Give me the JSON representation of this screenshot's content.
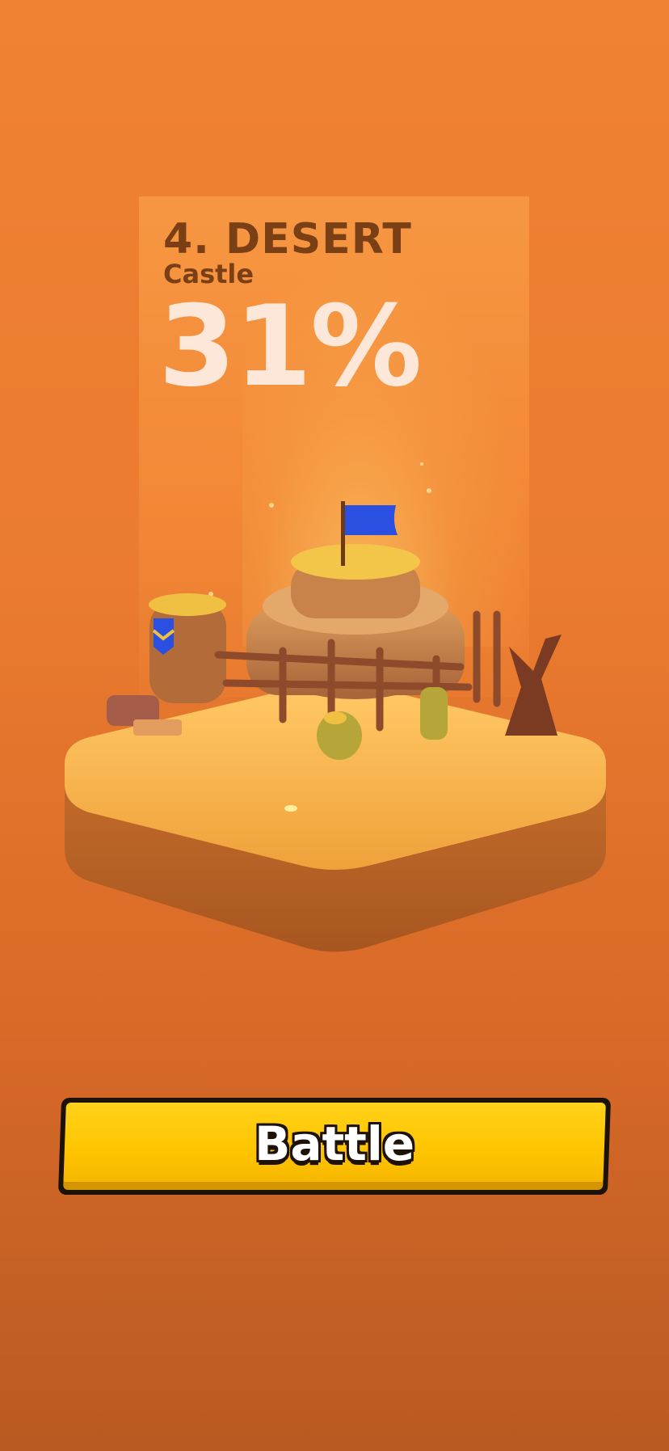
{
  "level": {
    "title": "4. DESERT",
    "subtitle": "Castle",
    "progress_text": "31%",
    "progress": 0.31
  },
  "scene": {
    "icon": "desert-castle-island",
    "flag_color": "#2b4fe0",
    "sand_color": "#f4a33a",
    "base_color": "#c3692a"
  },
  "actions": {
    "battle_label": "Battle"
  },
  "colors": {
    "background": "#ea7b2f",
    "title_text": "#7a3f14",
    "percent_text": "#fde7d8",
    "button_fill": "#ffc400"
  }
}
